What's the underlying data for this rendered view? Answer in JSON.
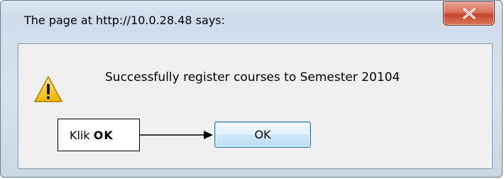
{
  "dialog": {
    "title": "The page at http://10.0.28.48 says:",
    "message": "Successfully register courses to Semester 20104",
    "icon": "warning-icon",
    "close_icon": "close-icon"
  },
  "buttons": {
    "ok_label": "OK"
  },
  "annotation": {
    "prefix": "Klik ",
    "emphasis": "OK"
  },
  "colors": {
    "close_button": "#c4462c",
    "ok_border": "#3c7fb1",
    "warning_fill": "#f5c518"
  }
}
